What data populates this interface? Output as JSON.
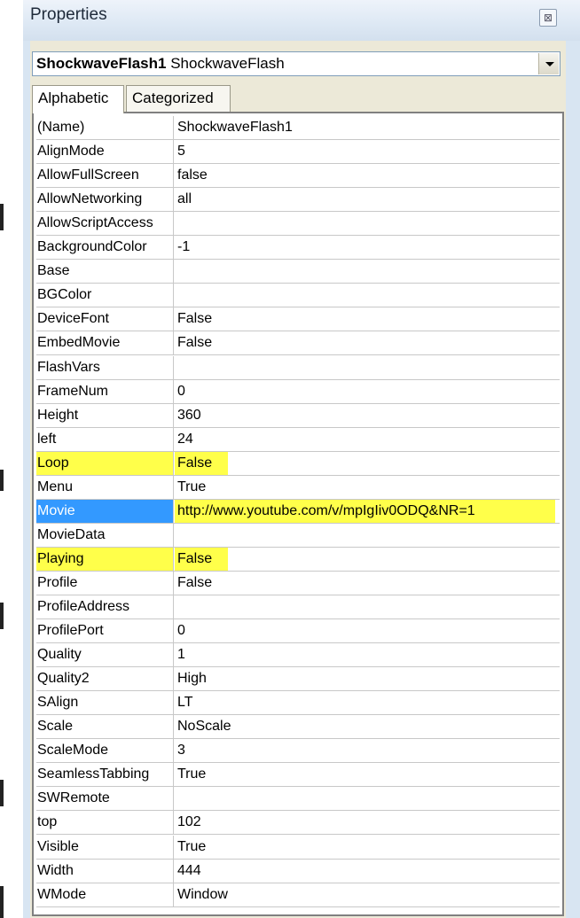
{
  "window": {
    "title": "Properties",
    "close_glyph": "⊠"
  },
  "object_selector": {
    "name": "ShockwaveFlash1",
    "type": "ShockwaveFlash"
  },
  "tabs": [
    {
      "label": "Alphabetic",
      "selected": true
    },
    {
      "label": "Categorized",
      "selected": false
    }
  ],
  "highlight_color": "#ffff4a",
  "selection_color": "#3399ff",
  "properties": [
    {
      "name": "(Name)",
      "value": "ShockwaveFlash1"
    },
    {
      "name": "AlignMode",
      "value": "5"
    },
    {
      "name": "AllowFullScreen",
      "value": "false"
    },
    {
      "name": "AllowNetworking",
      "value": "all"
    },
    {
      "name": "AllowScriptAccess",
      "value": ""
    },
    {
      "name": "BackgroundColor",
      "value": "-1"
    },
    {
      "name": "Base",
      "value": ""
    },
    {
      "name": "BGColor",
      "value": ""
    },
    {
      "name": "DeviceFont",
      "value": "False"
    },
    {
      "name": "EmbedMovie",
      "value": "False"
    },
    {
      "name": "FlashVars",
      "value": ""
    },
    {
      "name": "FrameNum",
      "value": "0"
    },
    {
      "name": "Height",
      "value": "360"
    },
    {
      "name": "left",
      "value": "24"
    },
    {
      "name": "Loop",
      "value": "False",
      "highlight": true
    },
    {
      "name": "Menu",
      "value": "True"
    },
    {
      "name": "Movie",
      "value": "http://www.youtube.com/v/mpIgIiv0ODQ&NR=1",
      "selected": true,
      "highlight": true
    },
    {
      "name": "MovieData",
      "value": ""
    },
    {
      "name": "Playing",
      "value": "False",
      "highlight": true
    },
    {
      "name": "Profile",
      "value": "False"
    },
    {
      "name": "ProfileAddress",
      "value": ""
    },
    {
      "name": "ProfilePort",
      "value": "0"
    },
    {
      "name": "Quality",
      "value": "1"
    },
    {
      "name": "Quality2",
      "value": "High"
    },
    {
      "name": "SAlign",
      "value": "LT"
    },
    {
      "name": "Scale",
      "value": "NoScale"
    },
    {
      "name": "ScaleMode",
      "value": "3"
    },
    {
      "name": "SeamlessTabbing",
      "value": "True"
    },
    {
      "name": "SWRemote",
      "value": ""
    },
    {
      "name": "top",
      "value": "102"
    },
    {
      "name": "Visible",
      "value": "True"
    },
    {
      "name": "Width",
      "value": "444"
    },
    {
      "name": "WMode",
      "value": "Window"
    }
  ]
}
